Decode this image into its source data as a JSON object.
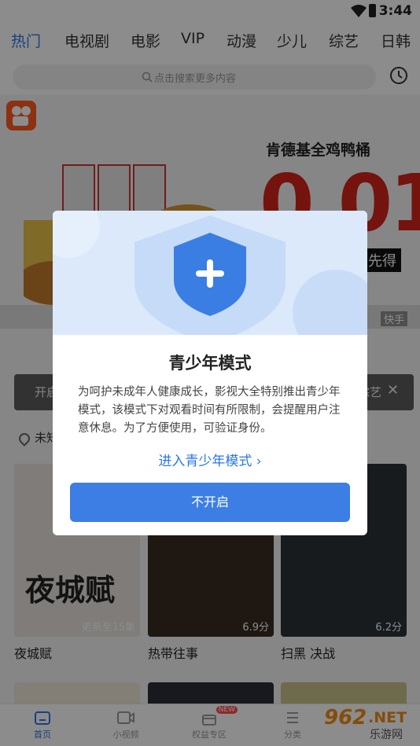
{
  "status": {
    "time": "3:44"
  },
  "tabs": [
    {
      "label": "热门"
    },
    {
      "label": "电视剧"
    },
    {
      "label": "电影"
    },
    {
      "label": "VIP"
    },
    {
      "label": "动漫"
    },
    {
      "label": "少儿"
    },
    {
      "label": "综艺"
    },
    {
      "label": "日韩"
    }
  ],
  "search": {
    "placeholder": "点击搜索更多内容"
  },
  "banner": {
    "headline": "肯德基全鸡鸭桶",
    "price": "0.01",
    "tagline": "先得",
    "source": "快手"
  },
  "tooltip": {
    "left_text": "开启",
    "right_text": "综艺"
  },
  "location": {
    "label": "未知"
  },
  "cards": [
    {
      "title": "夜城赋",
      "badge": "更新至15集",
      "poster_text": "夜城赋"
    },
    {
      "title": "热带往事",
      "badge": "6.9分"
    },
    {
      "title": "扫黑 决战",
      "badge": "6.2分"
    }
  ],
  "bottom_nav": [
    {
      "label": "首页",
      "icon": "home-icon"
    },
    {
      "label": "小视频",
      "icon": "video-icon"
    },
    {
      "label": "权益专区",
      "icon": "gift-icon",
      "badge": "NEW"
    },
    {
      "label": "分类",
      "icon": "category-icon"
    }
  ],
  "watermark": {
    "num": "962",
    "domain": ".NET",
    "sub": "乐游网"
  },
  "modal": {
    "title": "青少年模式",
    "body": "为呵护未成年人健康成长，影视大全特别推出青少年模式，该模式下对观看时间有所限制，会提醒用户注意休息。为了方便使用，可验证身份。",
    "link": "进入青少年模式",
    "button": "不开启"
  },
  "colors": {
    "accent": "#2a77e6",
    "button": "#3c7ee3",
    "price": "#d6241d"
  }
}
